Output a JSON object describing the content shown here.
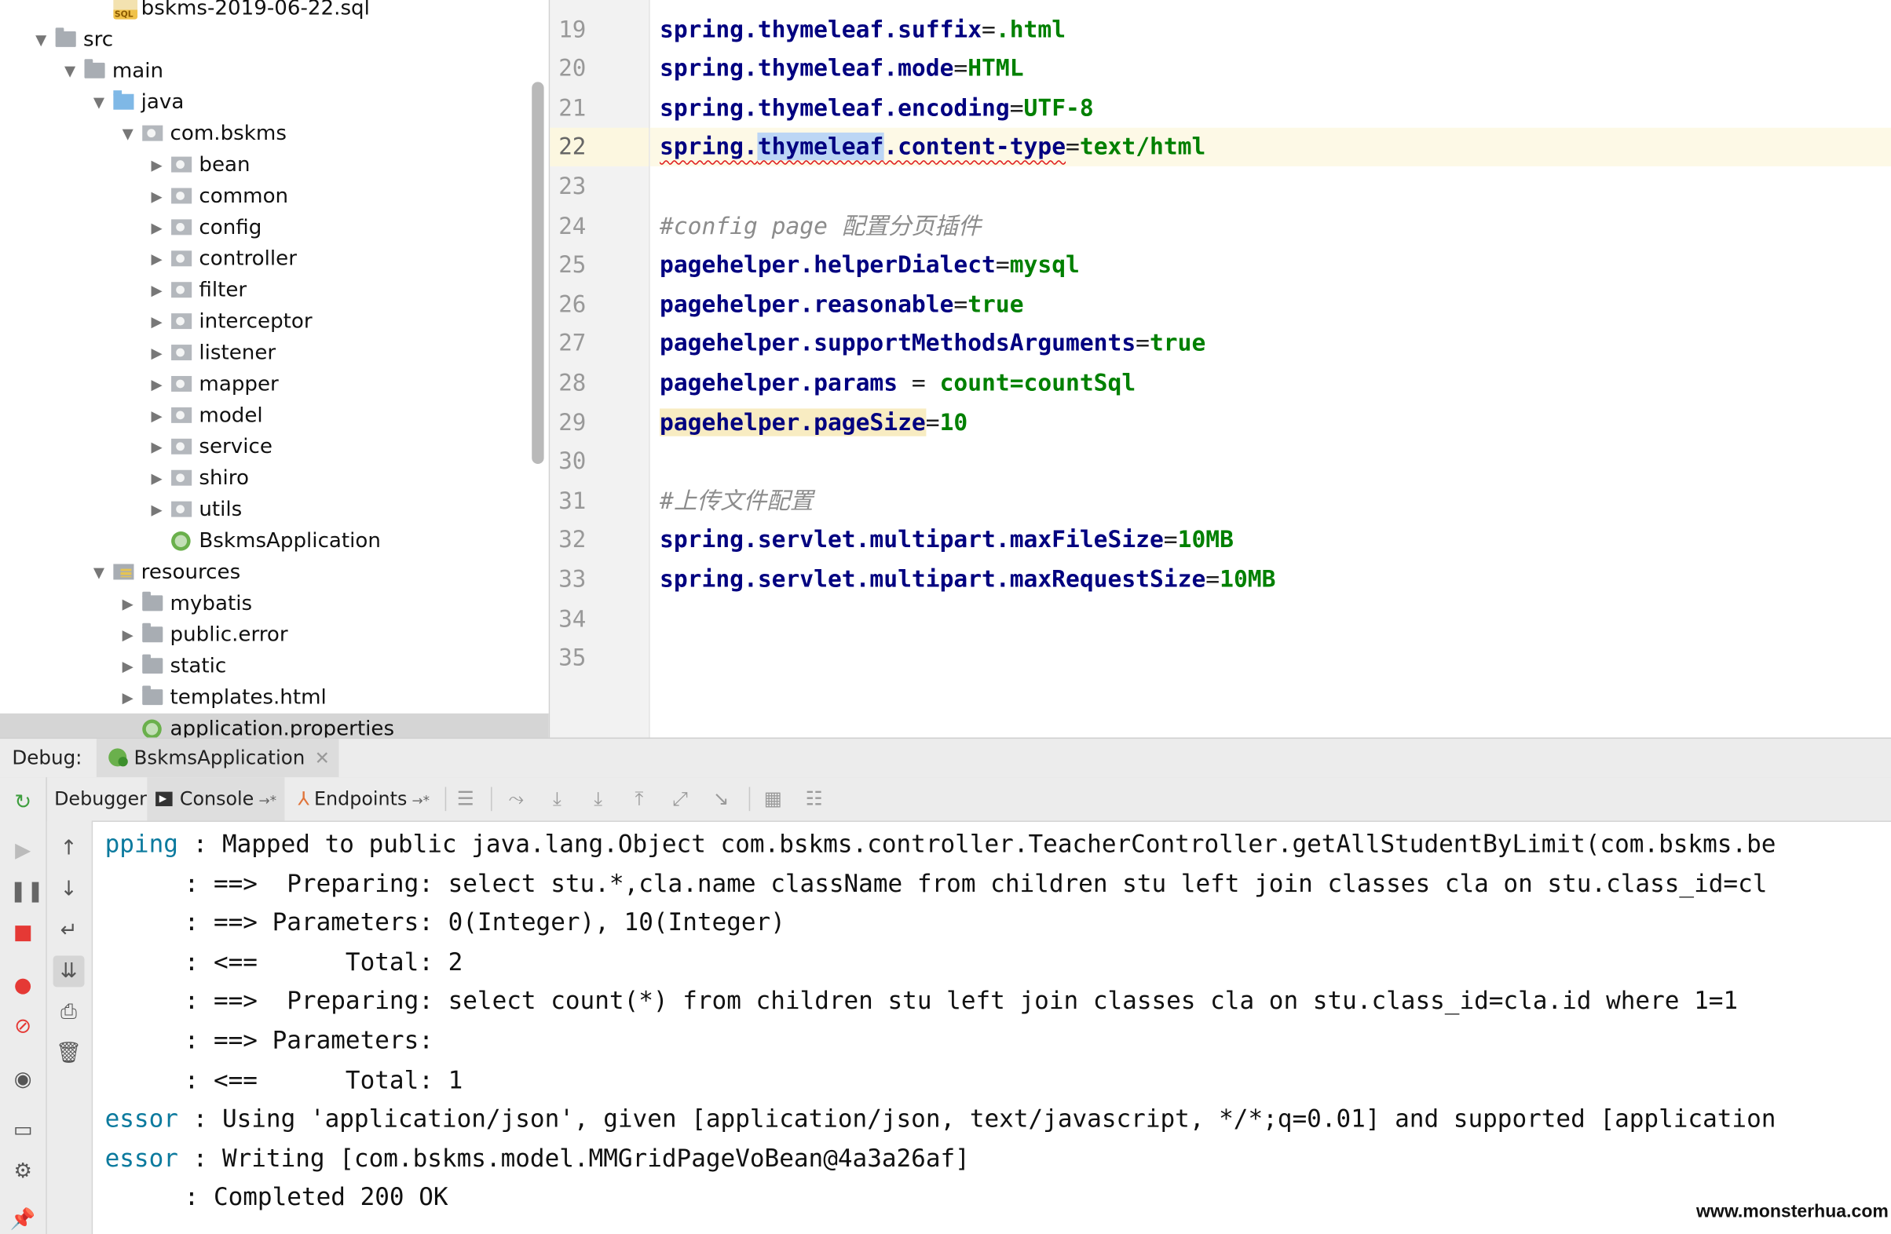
{
  "project_tree": [
    {
      "label": "bskms-2019-06-22.sql",
      "icon": "sql-file-icon",
      "arrow": ""
    },
    {
      "label": "src",
      "icon": "folder-icon",
      "arrow": "▼"
    },
    {
      "label": "main",
      "icon": "folder-icon",
      "arrow": "▼"
    },
    {
      "label": "java",
      "icon": "source-folder-icon",
      "arrow": "▼"
    },
    {
      "label": "com.bskms",
      "icon": "package-icon",
      "arrow": "▼"
    },
    {
      "label": "bean",
      "icon": "package-icon",
      "arrow": "▶"
    },
    {
      "label": "common",
      "icon": "package-icon",
      "arrow": "▶"
    },
    {
      "label": "config",
      "icon": "package-icon",
      "arrow": "▶"
    },
    {
      "label": "controller",
      "icon": "package-icon",
      "arrow": "▶"
    },
    {
      "label": "filter",
      "icon": "package-icon",
      "arrow": "▶"
    },
    {
      "label": "interceptor",
      "icon": "package-icon",
      "arrow": "▶"
    },
    {
      "label": "listener",
      "icon": "package-icon",
      "arrow": "▶"
    },
    {
      "label": "mapper",
      "icon": "package-icon",
      "arrow": "▶"
    },
    {
      "label": "model",
      "icon": "package-icon",
      "arrow": "▶"
    },
    {
      "label": "service",
      "icon": "package-icon",
      "arrow": "▶"
    },
    {
      "label": "shiro",
      "icon": "package-icon",
      "arrow": "▶"
    },
    {
      "label": "utils",
      "icon": "package-icon",
      "arrow": "▶"
    },
    {
      "label": "BskmsApplication",
      "icon": "spring-boot-class-icon",
      "arrow": ""
    },
    {
      "label": "resources",
      "icon": "resources-folder-icon",
      "arrow": "▼"
    },
    {
      "label": "mybatis",
      "icon": "folder-icon",
      "arrow": "▶"
    },
    {
      "label": "public.error",
      "icon": "folder-icon",
      "arrow": "▶"
    },
    {
      "label": "static",
      "icon": "folder-icon",
      "arrow": "▶"
    },
    {
      "label": "templates.html",
      "icon": "folder-icon",
      "arrow": "▶"
    },
    {
      "label": "application.properties",
      "icon": "spring-properties-icon",
      "arrow": ""
    }
  ],
  "editor": {
    "lines": [
      {
        "num": "19",
        "parts": [
          [
            "k",
            "spring.thymeleaf.suffix"
          ],
          [
            "p",
            "="
          ],
          [
            "v",
            ".html"
          ]
        ]
      },
      {
        "num": "20",
        "parts": [
          [
            "k",
            "spring.thymeleaf.mode"
          ],
          [
            "p",
            "="
          ],
          [
            "v",
            "HTML"
          ]
        ]
      },
      {
        "num": "21",
        "parts": [
          [
            "k",
            "spring.thymeleaf.encoding"
          ],
          [
            "p",
            "="
          ],
          [
            "v",
            "UTF-8"
          ]
        ]
      },
      {
        "num": "22",
        "parts": [
          [
            "k squig",
            "spring."
          ],
          [
            "k squig sel",
            "thymeleaf"
          ],
          [
            "k squig",
            ".content-type"
          ],
          [
            "p",
            "="
          ],
          [
            "v",
            "text/html"
          ]
        ],
        "current": true
      },
      {
        "num": "23",
        "parts": []
      },
      {
        "num": "24",
        "parts": [
          [
            "c",
            "#config page 配置分页插件"
          ]
        ]
      },
      {
        "num": "25",
        "parts": [
          [
            "k",
            "pagehelper.helperDialect"
          ],
          [
            "p",
            "="
          ],
          [
            "v",
            "mysql"
          ]
        ]
      },
      {
        "num": "26",
        "parts": [
          [
            "k",
            "pagehelper.reasonable"
          ],
          [
            "p",
            "="
          ],
          [
            "v",
            "true"
          ]
        ]
      },
      {
        "num": "27",
        "parts": [
          [
            "k",
            "pagehelper.supportMethodsArguments"
          ],
          [
            "p",
            "="
          ],
          [
            "v",
            "true"
          ]
        ]
      },
      {
        "num": "28",
        "parts": [
          [
            "k",
            "pagehelper.params"
          ],
          [
            "p",
            " = "
          ],
          [
            "v",
            "count=countSql"
          ]
        ]
      },
      {
        "num": "29",
        "parts": [
          [
            "k hl",
            "pagehelper.pageSize"
          ],
          [
            "p",
            "="
          ],
          [
            "v",
            "10"
          ]
        ]
      },
      {
        "num": "30",
        "parts": []
      },
      {
        "num": "31",
        "parts": [
          [
            "c",
            "#上传文件配置"
          ]
        ]
      },
      {
        "num": "32",
        "parts": [
          [
            "k",
            "spring.servlet.multipart.maxFileSize"
          ],
          [
            "p",
            "="
          ],
          [
            "v",
            "10MB"
          ]
        ]
      },
      {
        "num": "33",
        "parts": [
          [
            "k",
            "spring.servlet.multipart.maxRequestSize"
          ],
          [
            "p",
            "="
          ],
          [
            "v",
            "10MB"
          ]
        ]
      },
      {
        "num": "34",
        "parts": []
      },
      {
        "num": "35",
        "parts": []
      }
    ]
  },
  "debug": {
    "title": "Debug:",
    "run_tab": "BskmsApplication",
    "tabs": {
      "debugger": "Debugger",
      "console": "Console",
      "endpoints": "Endpoints"
    },
    "colors": {
      "accent_green": "#6ab04c",
      "stop_red": "#e53935",
      "console_source": "#0b7a9e"
    }
  },
  "console_lines": [
    {
      "src": "pping",
      "text": " : Mapped to public java.lang.Object com.bskms.controller.TeacherController.getAllStudentByLimit(com.bskms.be"
    },
    {
      "src": "",
      "text": "     : ==>  Preparing: select stu.*,cla.name className from children stu left join classes cla on stu.class_id=cl"
    },
    {
      "src": "",
      "text": "     : ==> Parameters: 0(Integer), 10(Integer)"
    },
    {
      "src": "",
      "text": "     : <==      Total: 2"
    },
    {
      "src": "",
      "text": "     : ==>  Preparing: select count(*) from children stu left join classes cla on stu.class_id=cla.id where 1=1"
    },
    {
      "src": "",
      "text": "     : ==> Parameters: "
    },
    {
      "src": "",
      "text": "     : <==      Total: 1"
    },
    {
      "src": "essor",
      "text": " : Using 'application/json', given [application/json, text/javascript, */*;q=0.01] and supported [application"
    },
    {
      "src": "essor",
      "text": " : Writing [com.bskms.model.MMGridPageVoBean@4a3a26af]"
    },
    {
      "src": "",
      "text": "     : Completed 200 OK"
    }
  ],
  "watermark": "www.monsterhua.com"
}
